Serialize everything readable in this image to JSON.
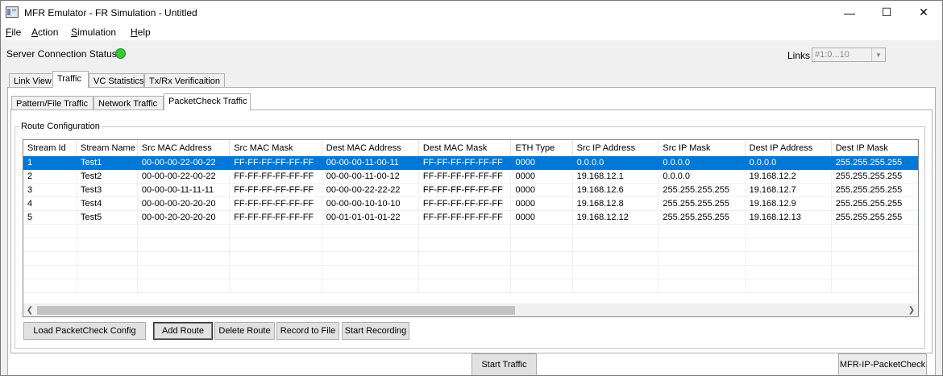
{
  "window": {
    "title": "MFR Emulator - FR Simulation - Untitled"
  },
  "menu": [
    {
      "label": "File",
      "key": "F",
      "rest": "ile"
    },
    {
      "label": "Action",
      "key": "A",
      "rest": "ction"
    },
    {
      "label": "Simulation",
      "key": "S",
      "rest": "imulation"
    },
    {
      "label": "Help",
      "key": "H",
      "rest": "elp"
    }
  ],
  "status": {
    "label": "Server Connection Status",
    "state_color": "#33cc33"
  },
  "links": {
    "label": "Links",
    "value": "#1:0...10"
  },
  "main_tabs": [
    "Link View",
    "Traffic",
    "VC Statistics",
    "Tx/Rx Verificaition"
  ],
  "sub_tabs": [
    "Pattern/File Traffic",
    "Network Traffic",
    "PacketCheck Traffic"
  ],
  "route_config": {
    "title": "Route Configuration",
    "columns": [
      "Stream Id",
      "Stream Name",
      "Src MAC Address",
      "Src MAC Mask",
      "Dest MAC Address",
      "Dest MAC Mask",
      "ETH Type",
      "Src IP Address",
      "Src IP Mask",
      "Dest IP Address",
      "Dest IP Mask"
    ],
    "rows": [
      [
        "1",
        "Test1",
        "00-00-00-22-00-22",
        "FF-FF-FF-FF-FF-FF",
        "00-00-00-11-00-11",
        "FF-FF-FF-FF-FF-FF",
        "0000",
        "0.0.0.0",
        "0.0.0.0",
        "0.0.0.0",
        "255.255.255.255"
      ],
      [
        "2",
        "Test2",
        "00-00-00-22-00-22",
        "FF-FF-FF-FF-FF-FF",
        "00-00-00-11-00-12",
        "FF-FF-FF-FF-FF-FF",
        "0000",
        "19.168.12.1",
        "0.0.0.0",
        "19.168.12.2",
        "255.255.255.255"
      ],
      [
        "3",
        "Test3",
        "00-00-00-11-11-11",
        "FF-FF-FF-FF-FF-FF",
        "00-00-00-22-22-22",
        "FF-FF-FF-FF-FF-FF",
        "0000",
        "19.168.12.6",
        "255.255.255.255",
        "19.168.12.7",
        "255.255.255.255"
      ],
      [
        "4",
        "Test4",
        "00-00-00-20-20-20",
        "FF-FF-FF-FF-FF-FF",
        "00-00-00-10-10-10",
        "FF-FF-FF-FF-FF-FF",
        "0000",
        "19.168.12.8",
        "255.255.255.255",
        "19.168.12.9",
        "255.255.255.255"
      ],
      [
        "5",
        "Test5",
        "00-00-20-20-20-20",
        "FF-FF-FF-FF-FF-FF",
        "00-01-01-01-01-22",
        "FF-FF-FF-FF-FF-FF",
        "0000",
        "19.168.12.12",
        "255.255.255.255",
        "19.168.12.13",
        "255.255.255.255"
      ]
    ],
    "selected_row": 0
  },
  "buttons": {
    "load_config": "Load PacketCheck Config",
    "add_route": "Add Route",
    "delete_route": "Delete Route",
    "record_to_file": "Record to File",
    "start_recording": "Start Recording",
    "start_traffic": "Start Traffic",
    "mode": "MFR-IP-PacketCheck"
  },
  "icons": {
    "minimize": "minimize-icon",
    "maximize": "maximize-icon",
    "close": "close-icon",
    "dropdown": "chevron-down-icon",
    "scroll_left": "chevron-left-icon",
    "scroll_right": "chevron-right-icon"
  }
}
